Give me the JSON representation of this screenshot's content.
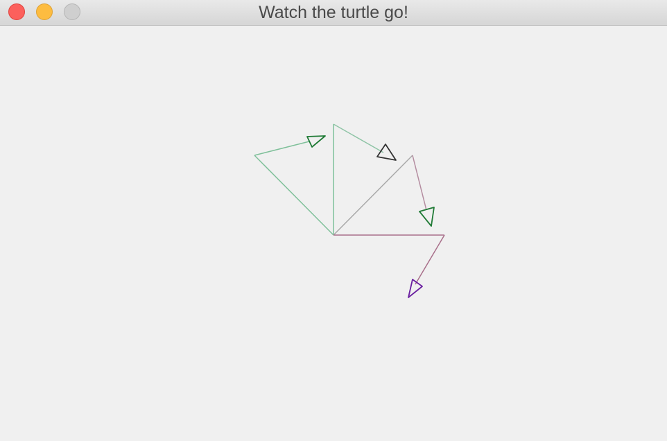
{
  "window": {
    "title": "Watch the turtle go!",
    "controls": {
      "close_color": "#fc605c",
      "minimize_color": "#fdbc40",
      "zoom_color": "#cfcfcf"
    }
  },
  "drawing": {
    "background": "#f0f0f0",
    "segment_colors": {
      "green": "#7fc09a",
      "teal": "#8fc4a6",
      "gray": "#a9a9a9",
      "mauve": "#b48ca0",
      "rose": "#a86f8a"
    },
    "turtle_colors": {
      "green": "#1f7a35",
      "black": "#333333",
      "purple": "#6a1fa0"
    }
  }
}
